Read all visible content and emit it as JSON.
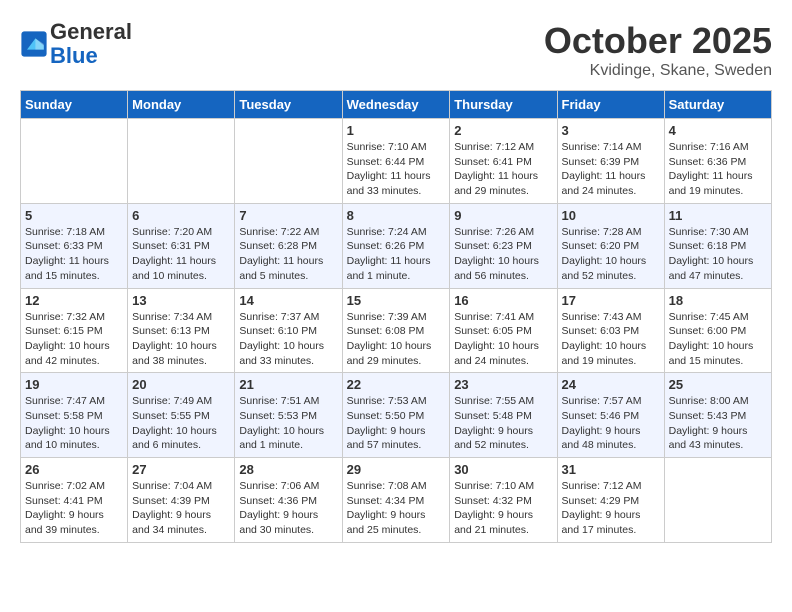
{
  "header": {
    "logo_line1": "General",
    "logo_line2": "Blue",
    "month": "October 2025",
    "location": "Kvidinge, Skane, Sweden"
  },
  "calendar": {
    "weekdays": [
      "Sunday",
      "Monday",
      "Tuesday",
      "Wednesday",
      "Thursday",
      "Friday",
      "Saturday"
    ],
    "weeks": [
      [
        {
          "day": "",
          "info": ""
        },
        {
          "day": "",
          "info": ""
        },
        {
          "day": "",
          "info": ""
        },
        {
          "day": "1",
          "info": "Sunrise: 7:10 AM\nSunset: 6:44 PM\nDaylight: 11 hours\nand 33 minutes."
        },
        {
          "day": "2",
          "info": "Sunrise: 7:12 AM\nSunset: 6:41 PM\nDaylight: 11 hours\nand 29 minutes."
        },
        {
          "day": "3",
          "info": "Sunrise: 7:14 AM\nSunset: 6:39 PM\nDaylight: 11 hours\nand 24 minutes."
        },
        {
          "day": "4",
          "info": "Sunrise: 7:16 AM\nSunset: 6:36 PM\nDaylight: 11 hours\nand 19 minutes."
        }
      ],
      [
        {
          "day": "5",
          "info": "Sunrise: 7:18 AM\nSunset: 6:33 PM\nDaylight: 11 hours\nand 15 minutes."
        },
        {
          "day": "6",
          "info": "Sunrise: 7:20 AM\nSunset: 6:31 PM\nDaylight: 11 hours\nand 10 minutes."
        },
        {
          "day": "7",
          "info": "Sunrise: 7:22 AM\nSunset: 6:28 PM\nDaylight: 11 hours\nand 5 minutes."
        },
        {
          "day": "8",
          "info": "Sunrise: 7:24 AM\nSunset: 6:26 PM\nDaylight: 11 hours\nand 1 minute."
        },
        {
          "day": "9",
          "info": "Sunrise: 7:26 AM\nSunset: 6:23 PM\nDaylight: 10 hours\nand 56 minutes."
        },
        {
          "day": "10",
          "info": "Sunrise: 7:28 AM\nSunset: 6:20 PM\nDaylight: 10 hours\nand 52 minutes."
        },
        {
          "day": "11",
          "info": "Sunrise: 7:30 AM\nSunset: 6:18 PM\nDaylight: 10 hours\nand 47 minutes."
        }
      ],
      [
        {
          "day": "12",
          "info": "Sunrise: 7:32 AM\nSunset: 6:15 PM\nDaylight: 10 hours\nand 42 minutes."
        },
        {
          "day": "13",
          "info": "Sunrise: 7:34 AM\nSunset: 6:13 PM\nDaylight: 10 hours\nand 38 minutes."
        },
        {
          "day": "14",
          "info": "Sunrise: 7:37 AM\nSunset: 6:10 PM\nDaylight: 10 hours\nand 33 minutes."
        },
        {
          "day": "15",
          "info": "Sunrise: 7:39 AM\nSunset: 6:08 PM\nDaylight: 10 hours\nand 29 minutes."
        },
        {
          "day": "16",
          "info": "Sunrise: 7:41 AM\nSunset: 6:05 PM\nDaylight: 10 hours\nand 24 minutes."
        },
        {
          "day": "17",
          "info": "Sunrise: 7:43 AM\nSunset: 6:03 PM\nDaylight: 10 hours\nand 19 minutes."
        },
        {
          "day": "18",
          "info": "Sunrise: 7:45 AM\nSunset: 6:00 PM\nDaylight: 10 hours\nand 15 minutes."
        }
      ],
      [
        {
          "day": "19",
          "info": "Sunrise: 7:47 AM\nSunset: 5:58 PM\nDaylight: 10 hours\nand 10 minutes."
        },
        {
          "day": "20",
          "info": "Sunrise: 7:49 AM\nSunset: 5:55 PM\nDaylight: 10 hours\nand 6 minutes."
        },
        {
          "day": "21",
          "info": "Sunrise: 7:51 AM\nSunset: 5:53 PM\nDaylight: 10 hours\nand 1 minute."
        },
        {
          "day": "22",
          "info": "Sunrise: 7:53 AM\nSunset: 5:50 PM\nDaylight: 9 hours\nand 57 minutes."
        },
        {
          "day": "23",
          "info": "Sunrise: 7:55 AM\nSunset: 5:48 PM\nDaylight: 9 hours\nand 52 minutes."
        },
        {
          "day": "24",
          "info": "Sunrise: 7:57 AM\nSunset: 5:46 PM\nDaylight: 9 hours\nand 48 minutes."
        },
        {
          "day": "25",
          "info": "Sunrise: 8:00 AM\nSunset: 5:43 PM\nDaylight: 9 hours\nand 43 minutes."
        }
      ],
      [
        {
          "day": "26",
          "info": "Sunrise: 7:02 AM\nSunset: 4:41 PM\nDaylight: 9 hours\nand 39 minutes."
        },
        {
          "day": "27",
          "info": "Sunrise: 7:04 AM\nSunset: 4:39 PM\nDaylight: 9 hours\nand 34 minutes."
        },
        {
          "day": "28",
          "info": "Sunrise: 7:06 AM\nSunset: 4:36 PM\nDaylight: 9 hours\nand 30 minutes."
        },
        {
          "day": "29",
          "info": "Sunrise: 7:08 AM\nSunset: 4:34 PM\nDaylight: 9 hours\nand 25 minutes."
        },
        {
          "day": "30",
          "info": "Sunrise: 7:10 AM\nSunset: 4:32 PM\nDaylight: 9 hours\nand 21 minutes."
        },
        {
          "day": "31",
          "info": "Sunrise: 7:12 AM\nSunset: 4:29 PM\nDaylight: 9 hours\nand 17 minutes."
        },
        {
          "day": "",
          "info": ""
        }
      ]
    ]
  }
}
